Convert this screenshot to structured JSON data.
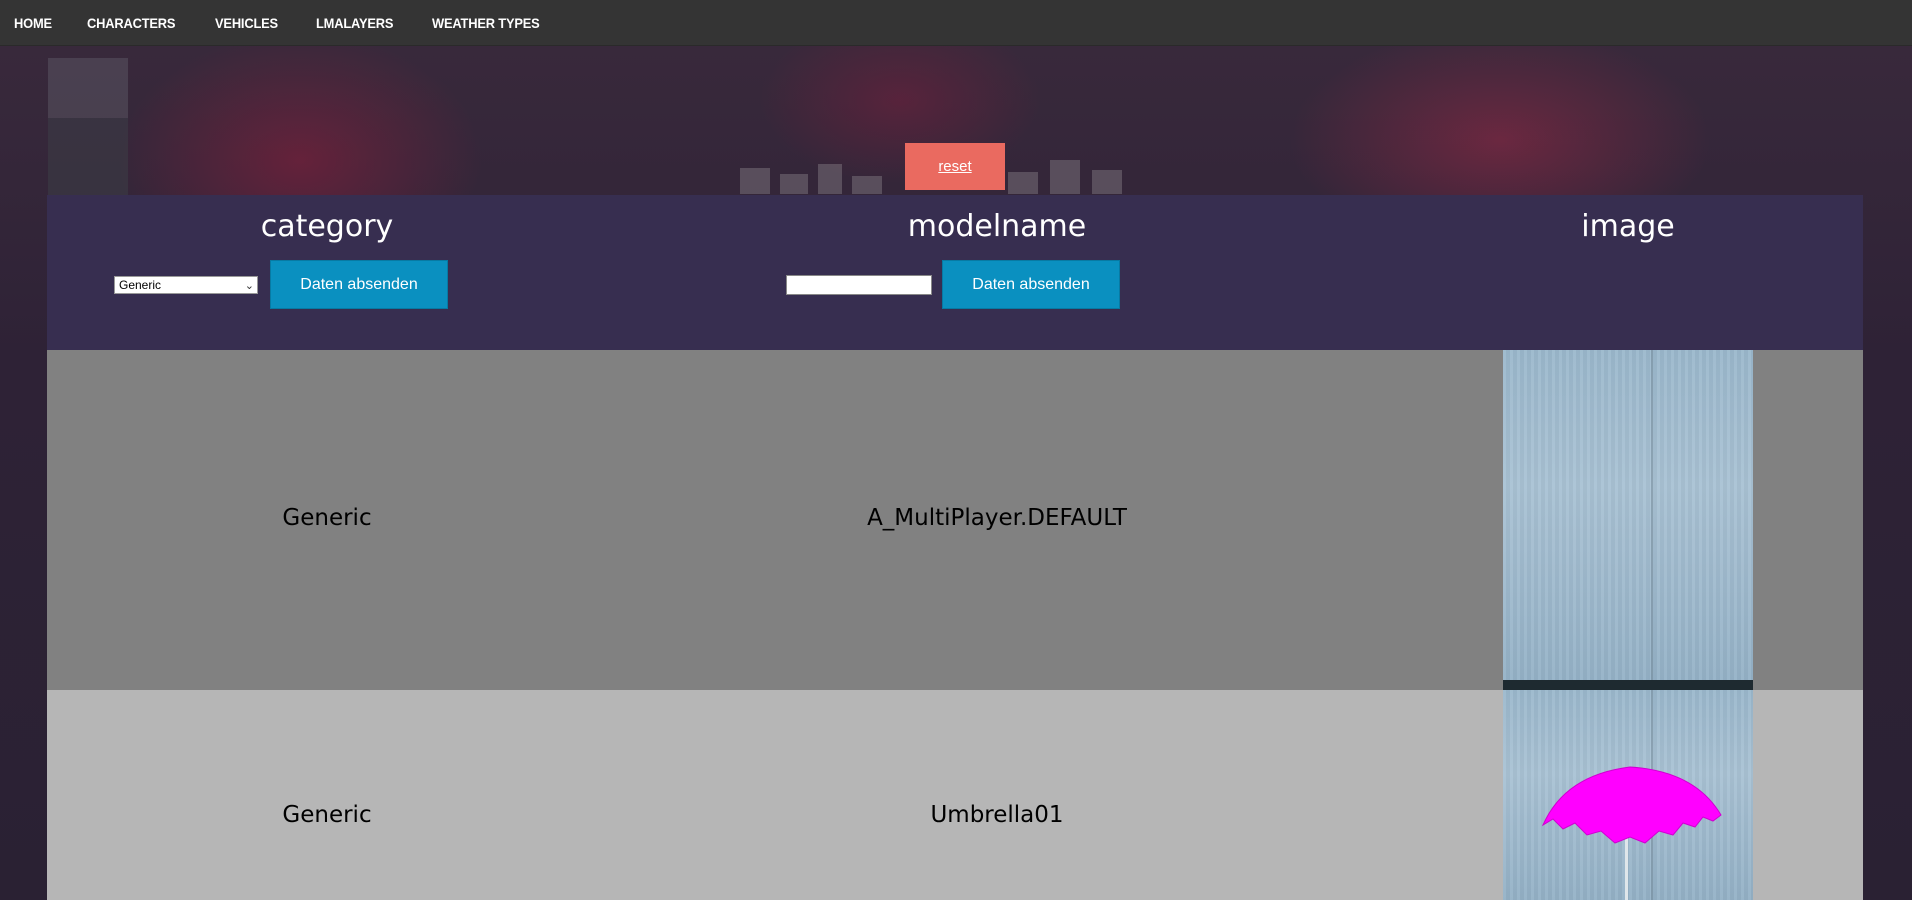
{
  "nav": {
    "items": [
      "HOME",
      "CHARACTERS",
      "VEHICLES",
      "LMALAYERS",
      "WEATHER TYPES"
    ]
  },
  "reset": {
    "label": "reset"
  },
  "table": {
    "headers": {
      "category": "category",
      "modelname": "modelname",
      "image": "image"
    },
    "category_filter": {
      "selected": "Generic",
      "submit_label": "Daten absenden"
    },
    "modelname_filter": {
      "value": "",
      "submit_label": "Daten absenden"
    },
    "rows": [
      {
        "category": "Generic",
        "modelname": "A_MultiPlayer.DEFAULT",
        "image": "concrete-wall-thumbnail"
      },
      {
        "category": "Generic",
        "modelname": "Umbrella01",
        "image": "magenta-umbrella-thumbnail"
      }
    ]
  },
  "colors": {
    "nav_bg": "#343434",
    "header_bg": "#372e50",
    "row_dark": "#818181",
    "row_light": "#b6b6b6",
    "reset_button": "#ea6a60",
    "submit_button": "#0a90c0",
    "umbrella": "#ff00ff"
  }
}
